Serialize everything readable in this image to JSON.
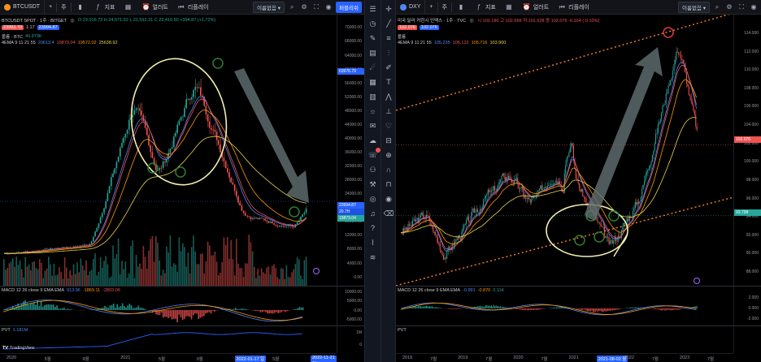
{
  "left": {
    "toolbar": {
      "symbol": "BTCUSDT",
      "plus": "+",
      "interval": "주",
      "indicators": "지표",
      "alert": "얼러트",
      "replay": "리플레이",
      "unsaved": "이름없음",
      "publish": "퍼블리쉬"
    },
    "legend": {
      "title": "BTCUSDT SPOT · 1주 · BITGET",
      "ohlc": "O 23,016.73 H 24,071.52 L 22,592.21 C 23,410.50 +394.87 (+1.72%)",
      "sell": "23993.70",
      "spread": "1.17",
      "buy": "23994.87",
      "volume_label": "볼륨 · BTC",
      "volume_value": "46.973K",
      "ema_label": "4EMA 9 11 21 55",
      "ema_v1": "20613.4",
      "ema_v2": "19873.04",
      "ema_v3": "19572.02",
      "ema_v4": "25638.92"
    },
    "price_axis": {
      "label": "USDT",
      "ticks": [
        "70000.00",
        "68000.00",
        "64000.00",
        "60000.00",
        "56000.00",
        "52000.00",
        "48000.00",
        "44000.00",
        "40000.00",
        "36000.00",
        "32000.00",
        "28000.00",
        "24000.00",
        "20000.00",
        "16000.00",
        "12000.00",
        "8000.00",
        "4000.00",
        "0.00"
      ],
      "tag_top": "63976.79",
      "tag_last": "23994.87",
      "tag_sub1": "20.7H",
      "tag_sub2": "19873.04"
    },
    "macd": {
      "label": "MACD 12 26 close 9 EMA EMA",
      "v1": "913.96",
      "v2": "-1869.11",
      "v3": "-2803.06",
      "ticks": [
        "10000.00",
        "5000.00",
        "0.00",
        "-5000.00"
      ]
    },
    "pvt": {
      "label": "PVT",
      "value": "1.181M",
      "ticks": [
        "1M",
        "0"
      ]
    },
    "time_axis": [
      "2020",
      "5월",
      "9월",
      "2021",
      "5월",
      "9월",
      "2022-01-17 일",
      "5월",
      "2022-11-21 일"
    ],
    "logo": "TradingView"
  },
  "right": {
    "toolbar": {
      "symbol": "DXY",
      "plus": "+",
      "interval": "주",
      "indicators": "지표",
      "alert": "얼러트",
      "replay": "리플레이",
      "unsaved": "이름없음"
    },
    "legend": {
      "title": "미국 달러 커런시 인덱스 · 1주 · TVC",
      "ohlc": "시 102.180 고 102.699 저 101.528 종 102.076 -0.104 (-0.10%)",
      "sell": "102.076",
      "buy": "102.076",
      "volume_label": "볼륨",
      "ema_label": "4EMA 9 11 21 55",
      "ema_v1": "105.235",
      "ema_v2": "105.122",
      "ema_v3": "105.716",
      "ema_v4": "103.900"
    },
    "price_axis": {
      "label": "USD",
      "ticks": [
        "114.000",
        "112.000",
        "110.000",
        "108.000",
        "106.000",
        "104.000",
        "102.000",
        "100.000",
        "98.000",
        "96.000",
        "94.000",
        "92.000",
        "90.000",
        "88.000"
      ],
      "tag_last": "102.076",
      "tag_sub": "93.798"
    },
    "macd": {
      "label": "MACD 12 26 close 9 EMA EMA",
      "v1": "-0.991",
      "v2": "-0.870",
      "v3": "0.114",
      "ticks": [
        "2.000",
        "0.000",
        "-2.000"
      ]
    },
    "pvt": {
      "label": "PVT"
    },
    "time_axis": [
      "2018",
      "7월",
      "2019",
      "7월",
      "2020",
      "7월",
      "2021",
      "2021-08-02 월",
      "2022",
      "7월",
      "2023",
      "7월"
    ]
  },
  "colors": {
    "up": "#26a69a",
    "down": "#ef5350",
    "accent": "#2962ff",
    "annotation_circle": "#f4f0b0",
    "annotation_arrow": "#5b6b6c",
    "channel": "#ff7f2a"
  }
}
